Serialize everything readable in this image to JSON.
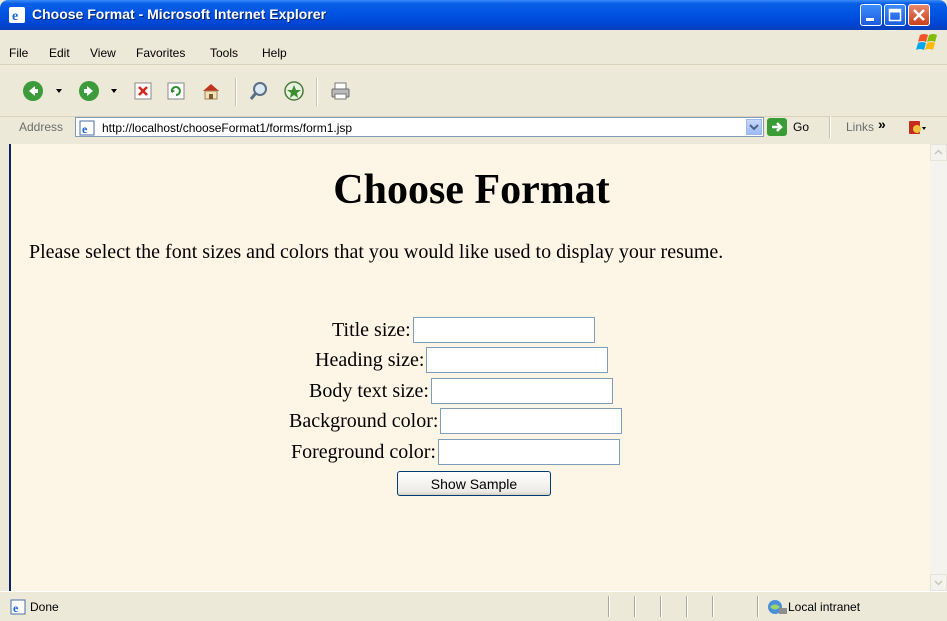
{
  "window": {
    "title": "Choose Format - Microsoft Internet Explorer"
  },
  "menu": {
    "items": [
      "File",
      "Edit",
      "View",
      "Favorites",
      "Tools",
      "Help"
    ]
  },
  "toolbar": {
    "buttons": [
      "back",
      "forward",
      "stop",
      "refresh",
      "home",
      "search",
      "favorites",
      "print"
    ]
  },
  "address_bar": {
    "label": "Address",
    "url": "http://localhost/chooseFormat1/forms/form1.jsp",
    "go_label": "Go",
    "links_label": "Links",
    "links_chevron": "»"
  },
  "page": {
    "title": "Choose Format",
    "instructions": "Please select the font sizes and colors that you would like used to display your resume.",
    "fields": [
      {
        "label": "Title size:",
        "value": ""
      },
      {
        "label": "Heading size:",
        "value": ""
      },
      {
        "label": "Body text size:",
        "value": ""
      },
      {
        "label": "Background color:",
        "value": ""
      },
      {
        "label": "Foreground color:",
        "value": ""
      }
    ],
    "submit_label": "Show Sample"
  },
  "status_bar": {
    "text": "Done",
    "zone": "Local intranet"
  },
  "colors": {
    "title_bar": "#0054e3",
    "page_background": "#fdf5e6",
    "chrome": "#ece9d8",
    "input_border": "#7f9db9"
  }
}
